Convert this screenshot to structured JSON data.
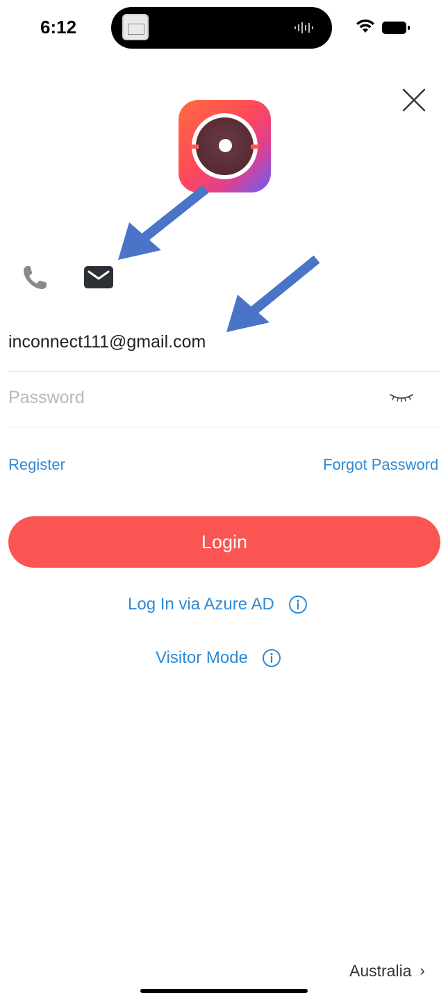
{
  "status_bar": {
    "time": "6:12"
  },
  "login_tabs": {
    "phone_icon": "phone-icon",
    "email_icon": "mail-icon"
  },
  "form": {
    "email_value": "inconnect111@gmail.com",
    "password_placeholder": "Password"
  },
  "links": {
    "register": "Register",
    "forgot_password": "Forgot Password"
  },
  "login_button": "Login",
  "alt_options": {
    "azure": "Log In via Azure AD",
    "visitor": "Visitor Mode"
  },
  "region": {
    "label": "Australia",
    "chevron": "›"
  },
  "colors": {
    "accent_red": "#fa5553",
    "link_blue": "#2e8ad6",
    "annotation_arrow": "#4a74c8"
  }
}
